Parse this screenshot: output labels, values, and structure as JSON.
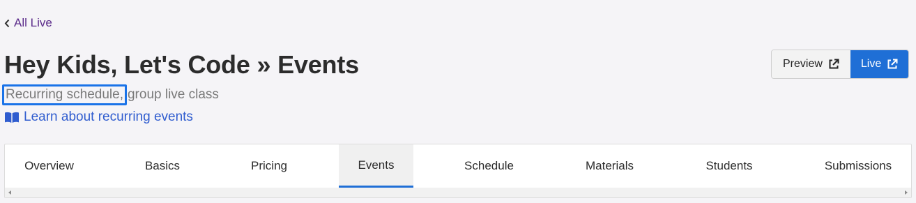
{
  "nav": {
    "back_label": "All Live"
  },
  "header": {
    "title": "Hey Kids, Let's Code » Events",
    "subtitle_highlighted": "Recurring schedule,",
    "subtitle_rest": "group live class",
    "learn_link": "Learn about recurring events"
  },
  "actions": {
    "preview_label": "Preview",
    "live_label": "Live"
  },
  "tabs": [
    {
      "label": "Overview"
    },
    {
      "label": "Basics"
    },
    {
      "label": "Pricing"
    },
    {
      "label": "Events",
      "active": true
    },
    {
      "label": "Schedule"
    },
    {
      "label": "Materials"
    },
    {
      "label": "Students"
    },
    {
      "label": "Submissions"
    }
  ],
  "colors": {
    "accent": "#1f6fd6",
    "link": "#2f5ccf",
    "back_link": "#5b2b8a",
    "highlight_border": "#1a73e8"
  },
  "icons": {
    "back": "chevron-left-icon",
    "learn": "open-book-icon",
    "external": "external-link-icon"
  }
}
